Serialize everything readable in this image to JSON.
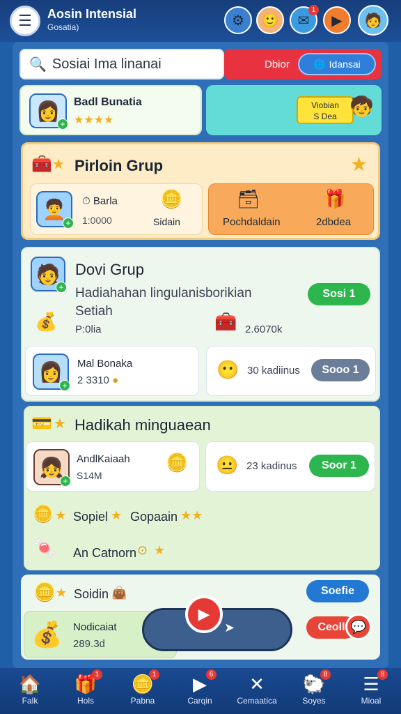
{
  "header": {
    "title": "Aosin Intensial",
    "subtitle": "Gosatia)",
    "icons": [
      {
        "name": "settings-icon",
        "glyph": "⚙",
        "bg": "#3a7fd0",
        "badge": ""
      },
      {
        "name": "profile-icon",
        "glyph": "🙂",
        "bg": "#f2b27a",
        "badge": ""
      },
      {
        "name": "message-icon",
        "glyph": "✉",
        "bg": "#3a9be0",
        "badge": "1"
      },
      {
        "name": "play-icon",
        "glyph": "▶",
        "bg": "#f07d2e",
        "badge": ""
      },
      {
        "name": "user-avatar-icon",
        "glyph": "🧑",
        "bg": "#6cc0f0",
        "badge": ""
      }
    ]
  },
  "search": {
    "placeholder": "Sosiai Ima linanai"
  },
  "segment": {
    "left": "Dbior",
    "right": "Idansai"
  },
  "profile_card": {
    "name": "Badl Bunatia",
    "stars": "★★★★"
  },
  "banner": {
    "line1": "Viobian",
    "line2": "S Dea"
  },
  "group1": {
    "title": "Pirloin Grup",
    "player": {
      "name": "Barla",
      "value": "1:0000",
      "caption": "Sidain"
    },
    "reward": {
      "left": "Pochdaldain",
      "right": "2dbdea"
    }
  },
  "group2": {
    "title": "Dovi Grup",
    "desc1": "Hadiahahan lingulanisborikian",
    "desc2": "Setiah",
    "join": "Sosi 1",
    "stat_left": "P:0lia",
    "stat_right": "2.6070k",
    "member": {
      "name": "Mal Bonaka",
      "value": "2 3310"
    },
    "member_right": {
      "label": "30 kadiinus",
      "button": "Sooo 1"
    }
  },
  "group3": {
    "title": "Hadikah minguaean",
    "member": {
      "name": "AndlKaiaah",
      "value": "S14M"
    },
    "member_right": {
      "label": "23 kadinus",
      "button": "Soor 1"
    },
    "row1": [
      "Sopiel",
      "Gopaain"
    ],
    "row2": "An Catnorn"
  },
  "footer_rows": {
    "label": "Soidin",
    "btn": "Soefie",
    "bottom_name": "Nodicaiat",
    "bottom_value": "289.3d",
    "btn2": "Ceoll"
  },
  "nav": [
    {
      "label": "Falk",
      "glyph": "🏠",
      "badge": ""
    },
    {
      "label": "Hols",
      "glyph": "🎁",
      "badge": "1"
    },
    {
      "label": "Pabna",
      "glyph": "🪙",
      "badge": "1"
    },
    {
      "label": "Carqin",
      "glyph": "▶",
      "badge": "6"
    },
    {
      "label": "Cemaatica",
      "glyph": "✕",
      "badge": ""
    },
    {
      "label": "Soyes",
      "glyph": "🐑",
      "badge": "8"
    },
    {
      "label": "Mioal",
      "glyph": "☰",
      "badge": "8"
    }
  ]
}
